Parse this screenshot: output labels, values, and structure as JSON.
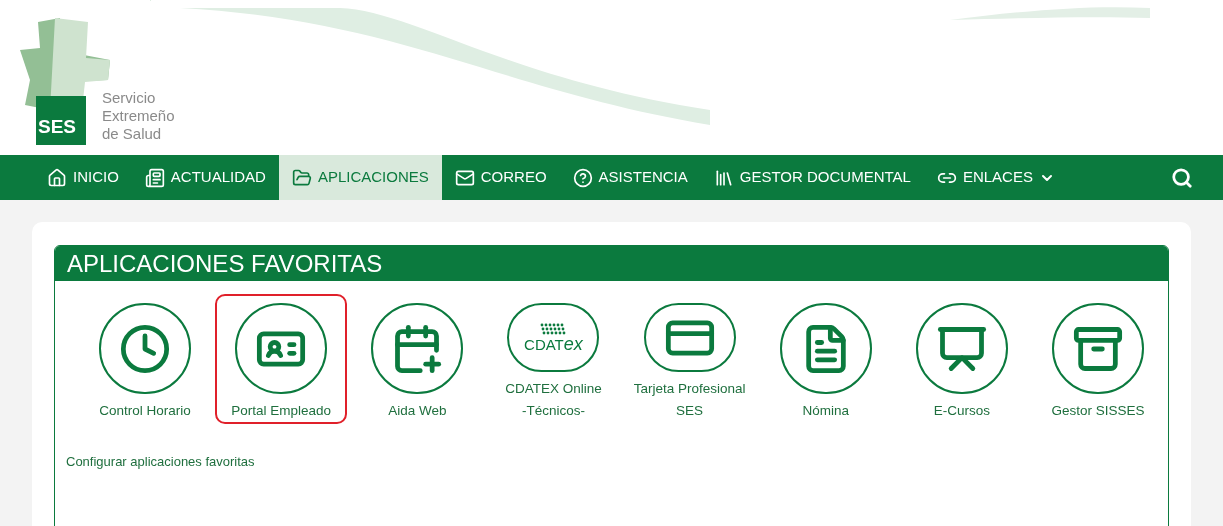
{
  "logo": {
    "badge": "SES",
    "lines": [
      "Servicio",
      "Extremeño",
      "de Salud"
    ]
  },
  "nav": [
    {
      "kind": "home",
      "label": "INICIO",
      "selected": false,
      "dropdown": false
    },
    {
      "kind": "news",
      "label": "ACTUALIDAD",
      "selected": false,
      "dropdown": false
    },
    {
      "kind": "folder",
      "label": "APLICACIONES",
      "selected": true,
      "dropdown": false
    },
    {
      "kind": "mail",
      "label": "CORREO",
      "selected": false,
      "dropdown": false
    },
    {
      "kind": "help",
      "label": "ASISTENCIA",
      "selected": false,
      "dropdown": false
    },
    {
      "kind": "books",
      "label": "GESTOR DOCUMENTAL",
      "selected": false,
      "dropdown": false
    },
    {
      "kind": "link",
      "label": "ENLACES",
      "selected": false,
      "dropdown": true
    }
  ],
  "panel": {
    "title": "APLICACIONES FAVORITAS",
    "apps": [
      {
        "kind": "clock",
        "label": [
          "Control Horario"
        ],
        "highlighted": false
      },
      {
        "kind": "badge",
        "label": [
          "Portal Empleado"
        ],
        "highlighted": true
      },
      {
        "kind": "calendar",
        "label": [
          "Aida Web"
        ],
        "highlighted": false
      },
      {
        "kind": "cdatex",
        "logo": [
          "CDAT",
          "ex"
        ],
        "label": [
          "CDATEX Online",
          "-Técnicos-"
        ],
        "highlighted": false
      },
      {
        "kind": "card",
        "label": [
          "Tarjeta Profesional",
          "SES"
        ],
        "highlighted": false
      },
      {
        "kind": "payslip",
        "label": [
          "Nómina"
        ],
        "highlighted": false
      },
      {
        "kind": "course",
        "label": [
          "E-Cursos"
        ],
        "highlighted": false
      },
      {
        "kind": "archive",
        "label": [
          "Gestor SISSES"
        ],
        "highlighted": false
      }
    ],
    "link": "Configurar aplicaciones favoritas"
  }
}
